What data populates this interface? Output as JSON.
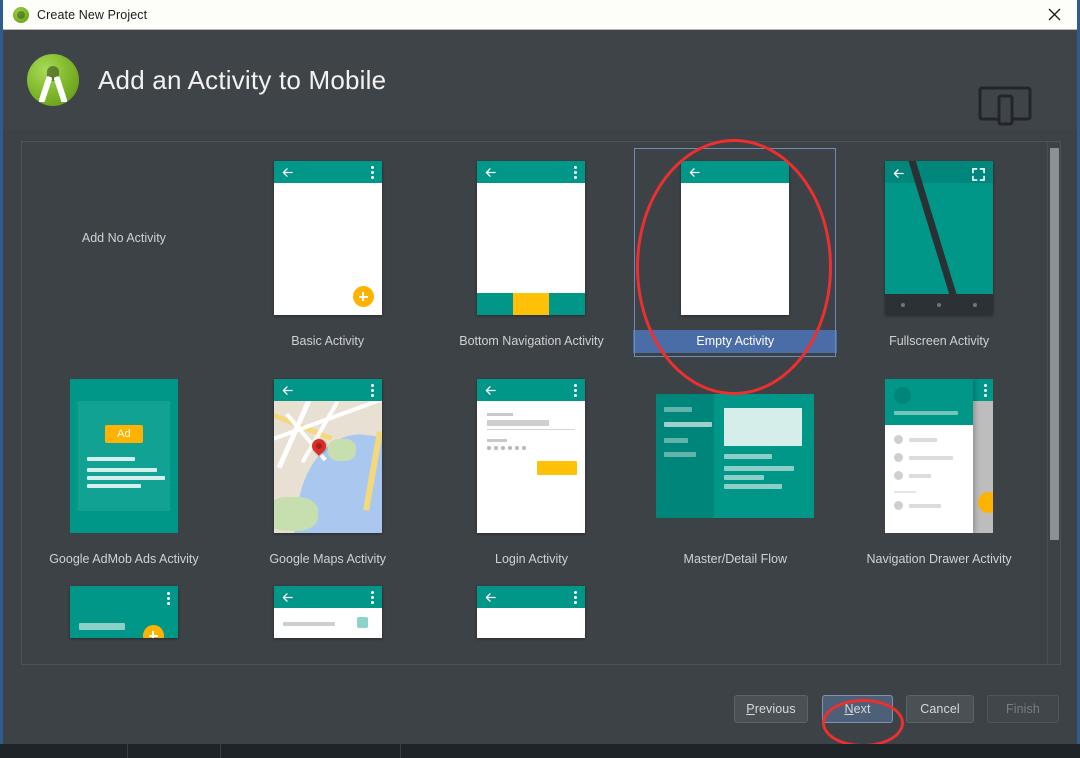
{
  "window": {
    "title": "Create New Project",
    "close_icon": "close-icon",
    "app_icon": "android-studio-icon"
  },
  "header": {
    "title": "Add an Activity to Mobile",
    "logo_icon": "android-studio-logo-icon",
    "device_icon": "tablet-phone-device-icon"
  },
  "gallery": {
    "rows": [
      {
        "cells": [
          {
            "label": "Add No Activity",
            "kind": "no-activity",
            "selected": false
          },
          {
            "label": "Basic Activity",
            "kind": "basic",
            "selected": false
          },
          {
            "label": "Bottom Navigation Activity",
            "kind": "bottom-nav",
            "selected": false
          },
          {
            "label": "Empty Activity",
            "kind": "empty",
            "selected": true
          },
          {
            "label": "Fullscreen Activity",
            "kind": "fullscreen",
            "selected": false
          }
        ]
      },
      {
        "cells": [
          {
            "label": "Google AdMob Ads Activity",
            "kind": "admob",
            "selected": false
          },
          {
            "label": "Google Maps Activity",
            "kind": "maps",
            "selected": false
          },
          {
            "label": "Login Activity",
            "kind": "login",
            "selected": false
          },
          {
            "label": "Master/Detail Flow",
            "kind": "master-detail",
            "selected": false
          },
          {
            "label": "Navigation Drawer Activity",
            "kind": "nav-drawer",
            "selected": false
          }
        ]
      },
      {
        "cells": [
          {
            "label": "",
            "kind": "scrolling",
            "selected": false
          },
          {
            "label": "",
            "kind": "settings",
            "selected": false
          },
          {
            "label": "",
            "kind": "tabbed",
            "selected": false
          }
        ]
      }
    ],
    "admob_badge_text": "Ad",
    "scrollbar": "vertical-scrollbar"
  },
  "footer": {
    "previous_label": "Previous",
    "previous_mnemonic": "P",
    "next_label": "Next",
    "next_mnemonic": "N",
    "cancel_label": "Cancel",
    "finish_label": "Finish",
    "finish_disabled": true
  },
  "annotations": [
    {
      "name": "empty-activity-highlight",
      "shape": "ellipse",
      "color": "#ee2f2f"
    },
    {
      "name": "next-button-highlight",
      "shape": "ellipse",
      "color": "#ee2f2f"
    }
  ],
  "colors": {
    "accent_teal": "#009688",
    "accent_amber": "#ffb300",
    "selection_blue": "#4a6da7",
    "window_border": "#2f5c8f",
    "panel_bg": "#3c4246",
    "annotation_red": "#ee2f2f"
  }
}
